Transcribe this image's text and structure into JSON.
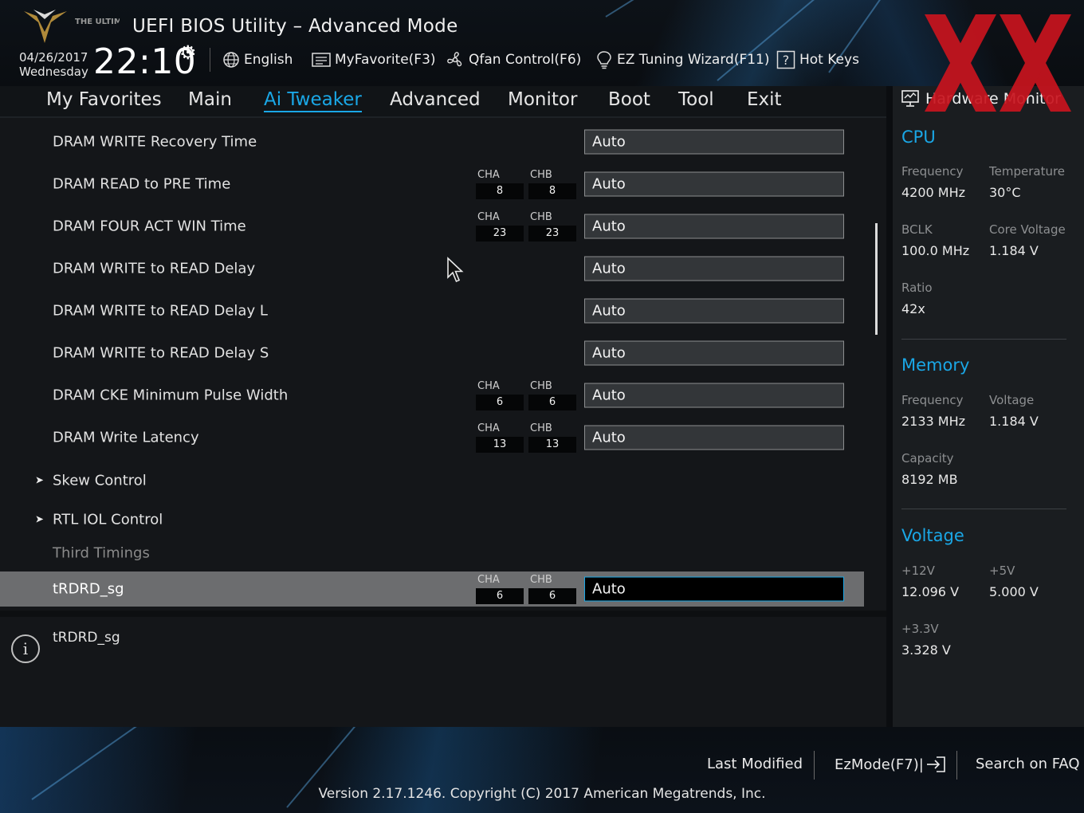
{
  "header": {
    "logo_text": "THE ULTIMATE FORCE",
    "title": "UEFI BIOS Utility – Advanced Mode",
    "date": "04/26/2017",
    "weekday": "Wednesday",
    "time": "22:10",
    "tools": [
      {
        "label": "English",
        "icon": "globe-icon"
      },
      {
        "label": "MyFavorite(F3)",
        "icon": "favorite-list-icon"
      },
      {
        "label": "Qfan Control(F6)",
        "icon": "fan-icon"
      },
      {
        "label": "EZ Tuning Wizard(F11)",
        "icon": "lightbulb-icon"
      },
      {
        "label": "Hot Keys",
        "icon": "question-box-icon"
      }
    ]
  },
  "nav": {
    "tabs": [
      "My Favorites",
      "Main",
      "Ai Tweaker",
      "Advanced",
      "Monitor",
      "Boot",
      "Tool",
      "Exit"
    ],
    "active": "Ai Tweaker"
  },
  "settings": {
    "channel_a": "CHA",
    "channel_b": "CHB",
    "rows": [
      {
        "label": "DRAM WRITE Recovery Time",
        "value": "Auto"
      },
      {
        "label": "DRAM READ to PRE Time",
        "cha": "8",
        "chb": "8",
        "value": "Auto"
      },
      {
        "label": "DRAM FOUR ACT WIN Time",
        "cha": "23",
        "chb": "23",
        "value": "Auto"
      },
      {
        "label": "DRAM WRITE to READ Delay",
        "value": "Auto"
      },
      {
        "label": "DRAM WRITE to READ Delay L",
        "value": "Auto"
      },
      {
        "label": "DRAM WRITE to READ Delay S",
        "value": "Auto"
      },
      {
        "label": "DRAM CKE Minimum Pulse Width",
        "cha": "6",
        "chb": "6",
        "value": "Auto"
      },
      {
        "label": "DRAM Write Latency",
        "cha": "13",
        "chb": "13",
        "value": "Auto"
      },
      {
        "label": "Skew Control"
      },
      {
        "label": "RTL IOL Control"
      },
      {
        "label": "Third Timings"
      },
      {
        "label": "tRDRD_sg",
        "cha": "6",
        "chb": "6",
        "value": "Auto"
      }
    ]
  },
  "help": {
    "text": "tRDRD_sg"
  },
  "hardware_monitor": {
    "title": "Hardware Monitor",
    "cpu": {
      "heading": "CPU",
      "frequency_label": "Frequency",
      "frequency": "4200 MHz",
      "temperature_label": "Temperature",
      "temperature": "30°C",
      "bclk_label": "BCLK",
      "bclk": "100.0 MHz",
      "core_voltage_label": "Core Voltage",
      "core_voltage": "1.184 V",
      "ratio_label": "Ratio",
      "ratio": "42x"
    },
    "memory": {
      "heading": "Memory",
      "frequency_label": "Frequency",
      "frequency": "2133 MHz",
      "voltage_label": "Voltage",
      "voltage": "1.184 V",
      "capacity_label": "Capacity",
      "capacity": "8192 MB"
    },
    "voltage": {
      "heading": "Voltage",
      "v12_label": "+12V",
      "v12": "12.096 V",
      "v5_label": "+5V",
      "v5": "5.000 V",
      "v33_label": "+3.3V",
      "v33": "3.328 V"
    }
  },
  "footer": {
    "last_modified": "Last Modified",
    "ezmode": "EzMode(F7)|",
    "search": "Search on FAQ",
    "version": "Version 2.17.1246. Copyright (C) 2017 American Megatrends, Inc."
  },
  "colors": {
    "accent": "#1aa7e6",
    "watermark": "#c8141e",
    "selected_row": "#6c6d6f"
  }
}
